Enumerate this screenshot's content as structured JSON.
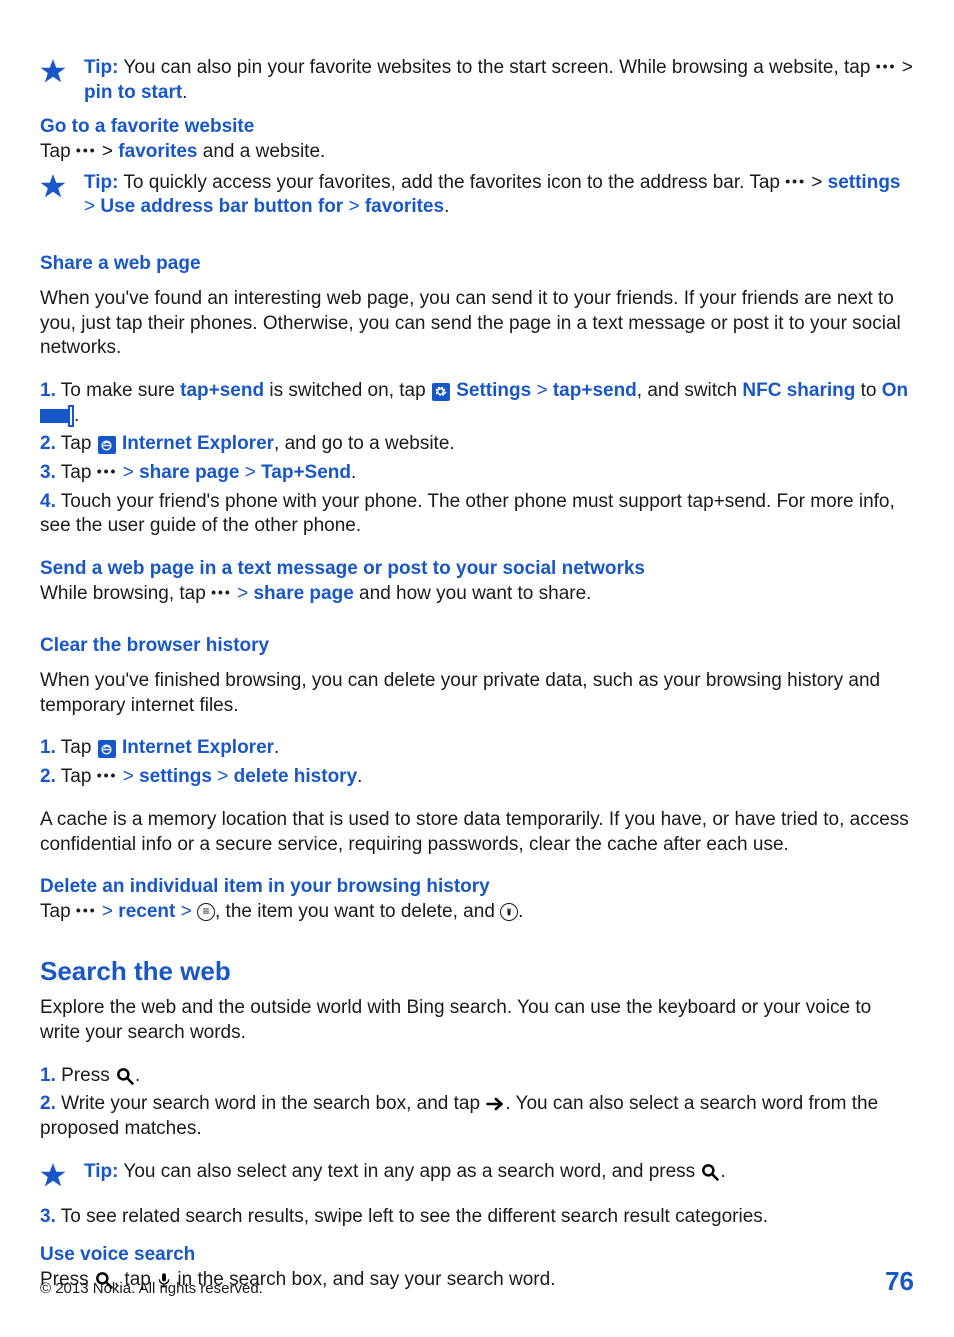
{
  "tip1": {
    "label": "Tip:",
    "text_a": " You can also pin your favorite websites to the start screen. While browsing a website, tap ",
    "text_b": " > ",
    "link": "pin to start",
    "text_c": "."
  },
  "fav_site": {
    "heading": "Go to a favorite website",
    "line_a": "Tap ",
    "line_b": " > ",
    "bold": "favorites",
    "line_c": " and a website."
  },
  "tip2": {
    "label": "Tip:",
    "text_a": " To quickly access your favorites, add the favorites icon to the address bar. Tap ",
    "text_b": " > ",
    "b1": "settings",
    "gt1": " > ",
    "b2": "Use address bar button for",
    "gt2": " > ",
    "b3": "favorites",
    "tail": "."
  },
  "share": {
    "heading": "Share a web page",
    "intro": "When you've found an interesting web page, you can send it to your friends. If your friends are next to you, just tap their phones. Otherwise, you can send the page in a text message or post it to your social networks.",
    "s1": {
      "num": "1.",
      "a": " To make sure ",
      "b": "tap+send",
      "c": " is switched on, tap ",
      "settings": "Settings",
      "gt": " > ",
      "tapsend": "tap+send",
      "d": ", and switch ",
      "nfc": "NFC sharing",
      "e": " to ",
      "on": "On",
      "f": "."
    },
    "s2": {
      "num": "2.",
      "a": " Tap ",
      "ie": "Internet Explorer",
      "b": ", and go to a website."
    },
    "s3": {
      "num": "3.",
      "a": " Tap ",
      "gt1": " > ",
      "sp": "share page",
      "gt2": " > ",
      "ts": "Tap+Send",
      "b": "."
    },
    "s4": {
      "num": "4.",
      "a": " Touch your friend's phone with your phone. The other phone must support tap+send. For more info, see the user guide of the other phone."
    }
  },
  "send_text": {
    "heading": "Send a web page in a text message or post to your social networks",
    "a": "While browsing, tap ",
    "gt": " > ",
    "sp": "share page",
    "b": " and how you want to share."
  },
  "clear": {
    "heading": "Clear the browser history",
    "intro": "When you've finished browsing, you can delete your private data, such as your browsing history and temporary internet files.",
    "s1": {
      "num": "1.",
      "a": " Tap ",
      "ie": "Internet Explorer",
      "b": "."
    },
    "s2": {
      "num": "2.",
      "a": " Tap ",
      "gt1": " > ",
      "settings": "settings",
      "gt2": " > ",
      "dh": "delete history",
      "b": "."
    },
    "cache": "A cache is a memory location that is used to store data temporarily. If you have, or have tried to, access confidential info or a secure service, requiring passwords, clear the cache after each use."
  },
  "delete_item": {
    "heading": "Delete an individual item in your browsing history",
    "a": "Tap ",
    "gt": " > ",
    "recent": "recent",
    "gt2": " > ",
    "b": ", the item you want to delete, and ",
    "c": "."
  },
  "search": {
    "title": "Search the web",
    "intro": "Explore the web and the outside world with Bing search. You can use the keyboard or your voice to write your search words.",
    "s1": {
      "num": "1.",
      "a": " Press ",
      "b": "."
    },
    "s2": {
      "num": "2.",
      "a": " Write your search word in the search box, and tap ",
      "b": ". You can also select a search word from the proposed matches."
    },
    "s3": {
      "num": "3.",
      "a": " To see related search results, swipe left to see the different search result categories."
    }
  },
  "tip3": {
    "label": "Tip:",
    "a": " You can also select any text in any app as a search word, and press ",
    "b": "."
  },
  "voice": {
    "heading": "Use voice search",
    "a": "Press ",
    "b": ", tap ",
    "c": " in the search box, and say your search word."
  },
  "footer": {
    "copyright": "© 2013 Nokia. All rights reserved.",
    "page": "76"
  }
}
